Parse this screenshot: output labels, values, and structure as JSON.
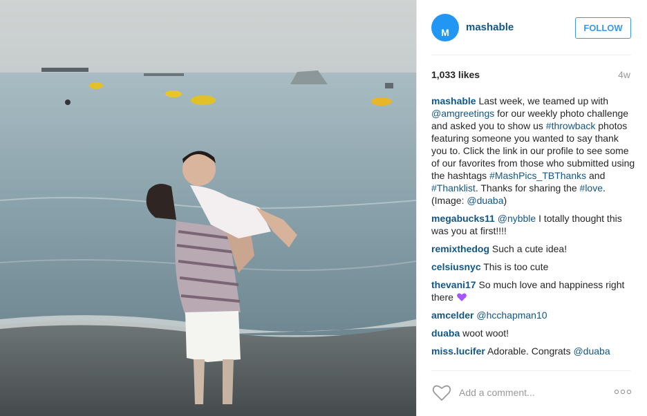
{
  "post": {
    "username": "mashable",
    "avatar_letter": "M",
    "follow_label": "FOLLOW",
    "likes": "1,033 likes",
    "time_ago": "4w",
    "add_comment_placeholder": "Add a comment...",
    "photo_icon": "beach-photo",
    "heart_icon": "heart-outline-icon",
    "more_icon": "more-options-icon"
  },
  "caption": {
    "user": "mashable",
    "t1": " Last week, we teamed up with ",
    "l1": "@amgreetings",
    "t2": " for our weekly photo challenge and asked you to show us ",
    "l2": "#throwback",
    "t3": " photos featuring someone you wanted to say thank you to. Click the link in our profile to see some of our favorites from those who submitted using the hashtags ",
    "l3": "#MashPics_TBThanks",
    "t4": " and ",
    "l4": "#Thanklist",
    "t5": ". Thanks for sharing the ",
    "l5": "#love",
    "t6": ". (Image: ",
    "l6": "@duaba",
    "t7": ")"
  },
  "comments": [
    {
      "user": "megabucks11",
      "mention": "@nybble",
      "text": " I totally thought this was you at first!!!!"
    },
    {
      "user": "remixthedog",
      "text": " Such a cute idea!"
    },
    {
      "user": "celsiusnyc",
      "text": " This is too cute"
    },
    {
      "user": "thevani17",
      "text": " So much love and happiness right there ",
      "emoji": "purple-heart-icon"
    },
    {
      "user": "amcelder",
      "mention": "@hcchapman10",
      "text": ""
    },
    {
      "user": "duaba",
      "text": " woot woot!"
    },
    {
      "user": "miss.lucifer",
      "text": " Adorable. Congrats ",
      "mention_after": "@duaba"
    }
  ],
  "colors": {
    "link": "#125688",
    "follow_blue": "#3897f0",
    "avatar_blue": "#2196f3",
    "muted": "#999999"
  }
}
